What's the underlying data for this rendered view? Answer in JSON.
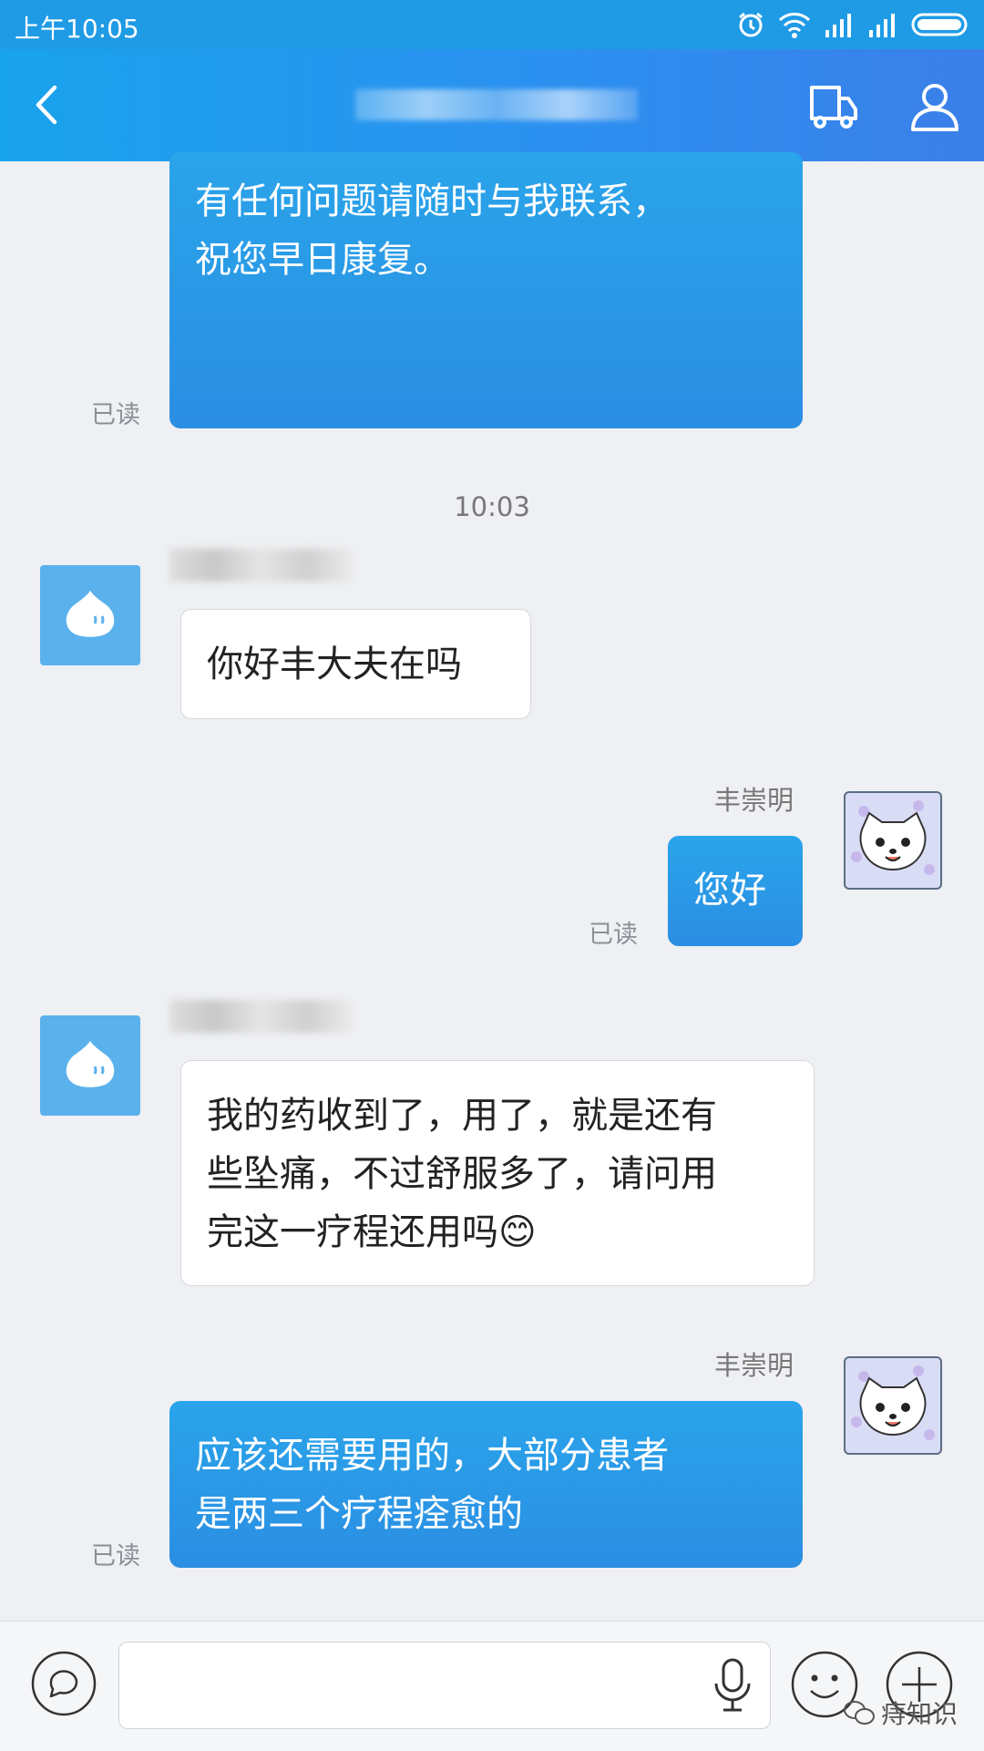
{
  "status_bar": {
    "time": "上午10:05"
  },
  "header": {
    "title": "",
    "back_icon": "chevron-left-icon",
    "cart_icon": "cart-icon",
    "profile_icon": "person-icon"
  },
  "messages": {
    "m1": {
      "text": "有任何问题请随时与我联系，\n祝您早日康复。",
      "status": "已读"
    },
    "timestamp": "10:03",
    "m2": {
      "text": "你好丰大夫在吗"
    },
    "m3": {
      "sender": "丰崇明",
      "text": "您好",
      "status": "已读"
    },
    "m4": {
      "text": "我的药收到了，用了，就是还有\n些坠痛，不过舒服多了，请问用\n完这一疗程还用吗😊"
    },
    "m5": {
      "sender": "丰崇明",
      "text": "应该还需要用的，大部分患者\n是两三个疗程痊愈的",
      "status": "已读"
    }
  },
  "input": {
    "placeholder": "",
    "value": ""
  },
  "watermark": {
    "text": "痔知识"
  },
  "colors": {
    "header": "#2d8ff0",
    "outgoing_bubble": "#2a9be8",
    "app_avatar": "#5ab1ec"
  }
}
